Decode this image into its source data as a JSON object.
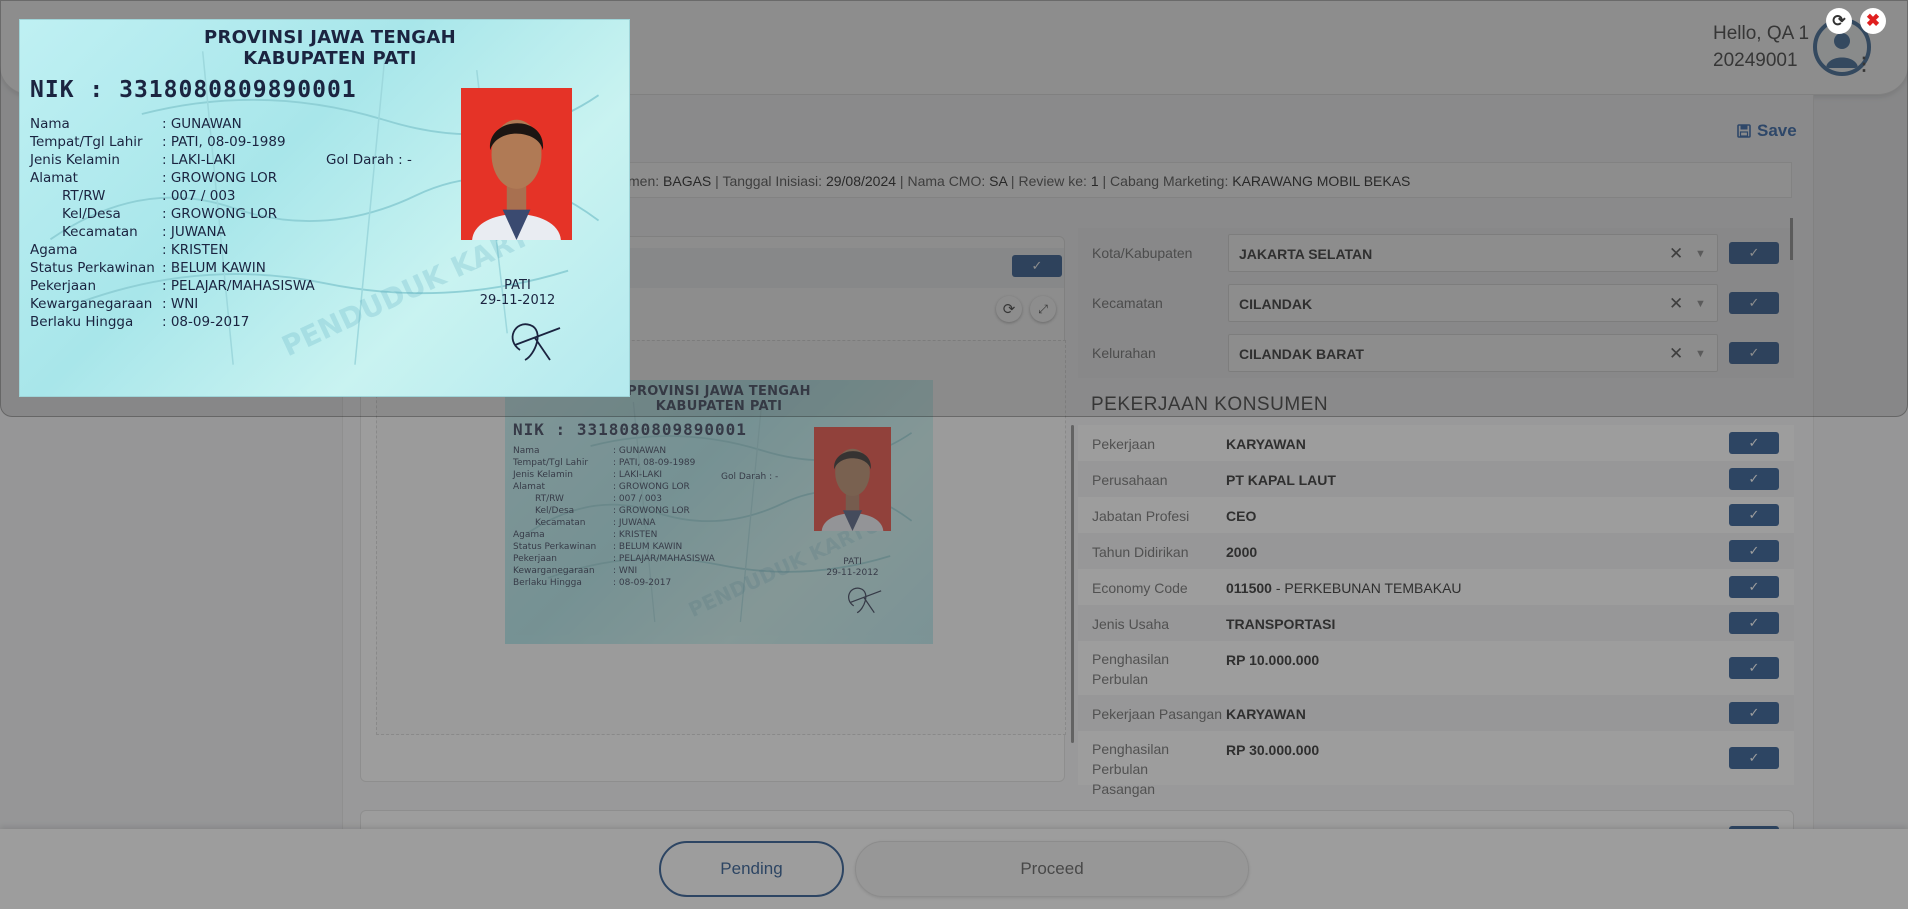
{
  "header": {
    "greeting": "Hello, QA 1",
    "user_id": "20249001"
  },
  "toolbar": {
    "save_label": "Save"
  },
  "info_bar": {
    "konsumen_label": "men:",
    "konsumen_value": "BAGAS",
    "tanggal_label": "Tanggal Inisiasi:",
    "tanggal_value": "29/08/2024",
    "cmo_label": "Nama CMO:",
    "cmo_value": "SA",
    "review_label": "Review ke:",
    "review_value": "1",
    "cabang_label": "Cabang Marketing:",
    "cabang_value": "KARAWANG MOBIL BEKAS"
  },
  "address": [
    {
      "label": "Kota/Kabupaten",
      "value": "JAKARTA SELATAN"
    },
    {
      "label": "Kecamatan",
      "value": "CILANDAK"
    },
    {
      "label": "Kelurahan",
      "value": "CILANDAK BARAT"
    }
  ],
  "pekerjaan": {
    "section_title": "PEKERJAAN KONSUMEN",
    "rows": [
      {
        "label": "Pekerjaan",
        "value": "KARYAWAN"
      },
      {
        "label": "Perusahaan",
        "value": "PT KAPAL LAUT"
      },
      {
        "label": "Jabatan Profesi",
        "value": "CEO"
      },
      {
        "label": "Tahun Didirikan",
        "value": "2000"
      },
      {
        "label": "Economy Code",
        "value": "011500",
        "value_extra": " - PERKEBUNAN TEMBAKAU"
      },
      {
        "label": "Jenis Usaha",
        "value": "TRANSPORTASI"
      },
      {
        "label": "Penghasilan Perbulan",
        "value": "RP 10.000.000"
      },
      {
        "label": "Pekerjaan Pasangan",
        "value": "KARYAWAN"
      },
      {
        "label": "Penghasilan Perbulan Pasangan",
        "value": "RP 30.000.000"
      }
    ]
  },
  "ktp": {
    "province_line1": "PROVINSI JAWA TENGAH",
    "province_line2": "KABUPATEN PATI",
    "nik_label": "NIK",
    "nik_value": ": 3318080809890001",
    "fields": [
      {
        "label": "Nama",
        "value": ": GUNAWAN"
      },
      {
        "label": "Tempat/Tgl Lahir",
        "value": ": PATI, 08-09-1989"
      },
      {
        "label": "Jenis Kelamin",
        "value": ": LAKI-LAKI"
      },
      {
        "label": "Alamat",
        "value": ": GROWONG LOR"
      },
      {
        "label": "RT/RW",
        "value": ": 007 / 003"
      },
      {
        "label": "Kel/Desa",
        "value": ": GROWONG LOR"
      },
      {
        "label": "Kecamatan",
        "value": ": JUWANA"
      },
      {
        "label": "Agama",
        "value": ": KRISTEN"
      },
      {
        "label": "Status Perkawinan",
        "value": ": BELUM KAWIN"
      },
      {
        "label": "Pekerjaan",
        "value": ": PELAJAR/MAHASISWA"
      },
      {
        "label": "Kewarganegaraan",
        "value": ": WNI"
      },
      {
        "label": "Berlaku Hingga",
        "value": ": 08-09-2017"
      }
    ],
    "gol_darah": "Gol Darah  : -",
    "city": "PATI",
    "issue_date": "29-11-2012",
    "watermark": "PENDUDUK KARTU"
  },
  "footer": {
    "pending_label": "Pending",
    "proceed_label": "Proceed"
  },
  "icons": {
    "checkmark": "checkmark-icon",
    "refresh": "refresh-icon",
    "expand": "expand-icon",
    "close": "close-icon",
    "save": "save-icon"
  },
  "colors": {
    "primary": "#1e4f8a",
    "save_text": "#1e5aa8",
    "close_red": "#e02020",
    "ktp_background": "#b4e9ee",
    "photo_background": "#e53327"
  }
}
